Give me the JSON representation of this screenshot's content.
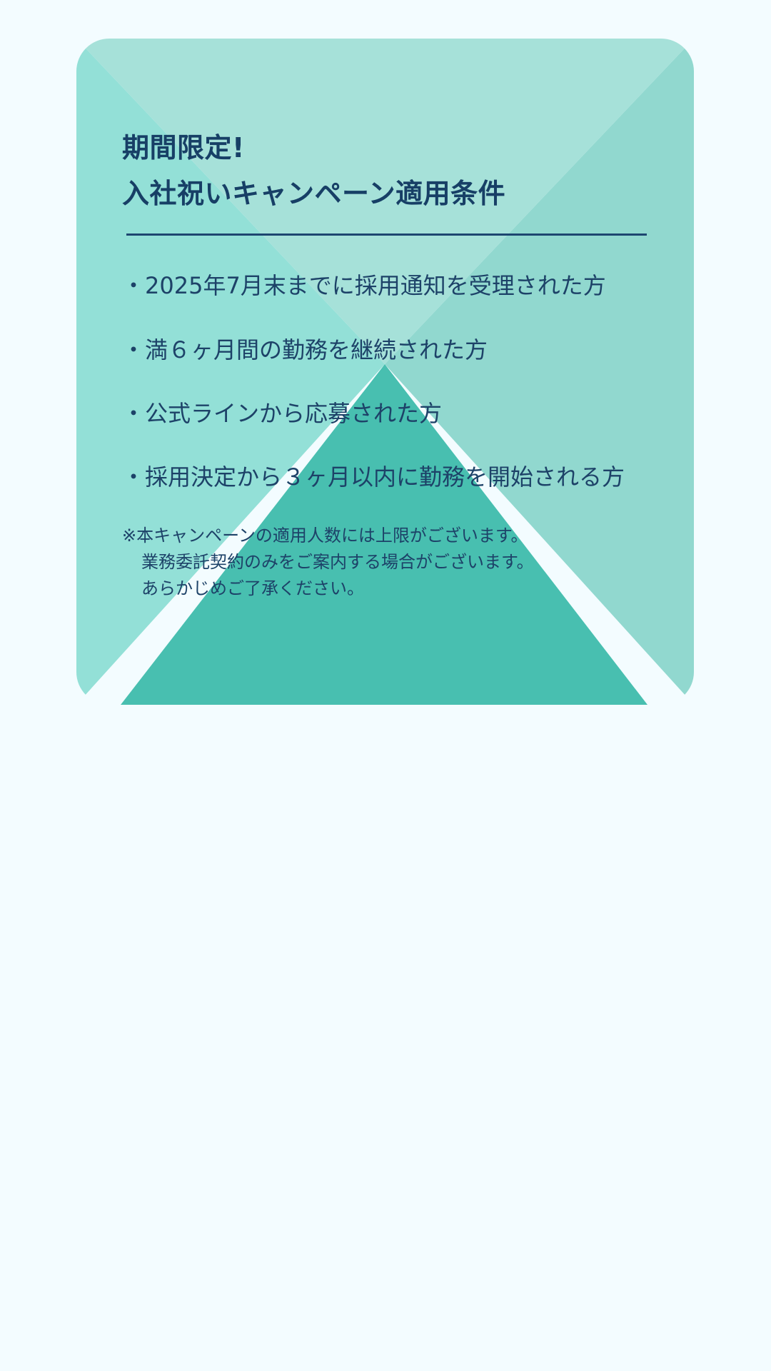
{
  "campaign": {
    "title_line1": "期間限定!",
    "title_line2": "入社祝いキャンペーン適用条件",
    "conditions": [
      "・2025年7月末までに採用通知を受理された方",
      "・満６ヶ月間の勤務を継続された方",
      "・公式ラインから応募された方",
      "・採用決定から３ヶ月以内に勤務を開始される方"
    ],
    "notes": [
      "※本キャンペーンの適用人数には上限がございます。",
      "業務委託契約のみをご案内する場合がございます。",
      "あらかじめご了承ください。"
    ]
  },
  "colors": {
    "page_background": "#f3fcff",
    "card_left": "#93e0d7",
    "card_top": "#a6e1d9",
    "card_right": "#91d8cf",
    "card_bottom_triangle": "#48bfb0",
    "text": "#1a3d63"
  }
}
